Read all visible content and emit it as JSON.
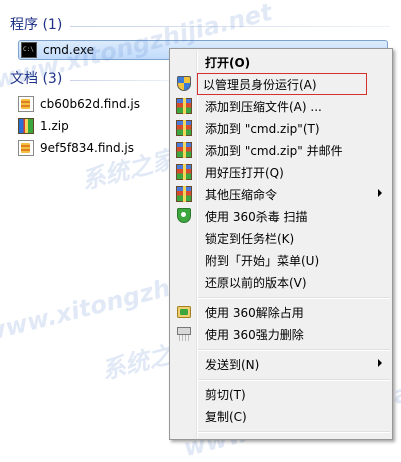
{
  "results": {
    "programs_header": "程序 (1)",
    "programs": [
      {
        "name": "cmd.exe",
        "icon": "cmd-icon"
      }
    ],
    "docs_header": "文档 (3)",
    "docs": [
      {
        "name": "cb60b62d.find.js",
        "icon": "js-file-icon"
      },
      {
        "name": "1.zip",
        "icon": "zip-file-icon"
      },
      {
        "name": "9ef5f834.find.js",
        "icon": "js-file-icon"
      }
    ]
  },
  "watermark": {
    "text": "www.xitongzhijia.net",
    "cn_text": "系统之家"
  },
  "context_menu": {
    "open": "打开(O)",
    "run_as_admin": "以管理员身份运行(A)",
    "add_to_archive": "添加到压缩文件(A) ...",
    "add_to_zip": "添加到 \"cmd.zip\"(T)",
    "add_to_zip_mail": "添加到 \"cmd.zip\" 并邮件",
    "open_with_haozip": "用好压打开(Q)",
    "other_commands": "其他压缩命令",
    "scan_360": "使用 360杀毒 扫描",
    "pin_taskbar": "锁定到任务栏(K)",
    "pin_start": "附到「开始」菜单(U)",
    "restore_versions": "还原以前的版本(V)",
    "unlock_360": "使用 360解除占用",
    "shred_360": "使用 360强力删除",
    "send_to": "发送到(N)",
    "cut": "剪切(T)",
    "copy": "复制(C)"
  },
  "colors": {
    "highlight_border": "#d43030",
    "header_blue": "#1e3287",
    "selection_bg": "#c1dbfc"
  }
}
